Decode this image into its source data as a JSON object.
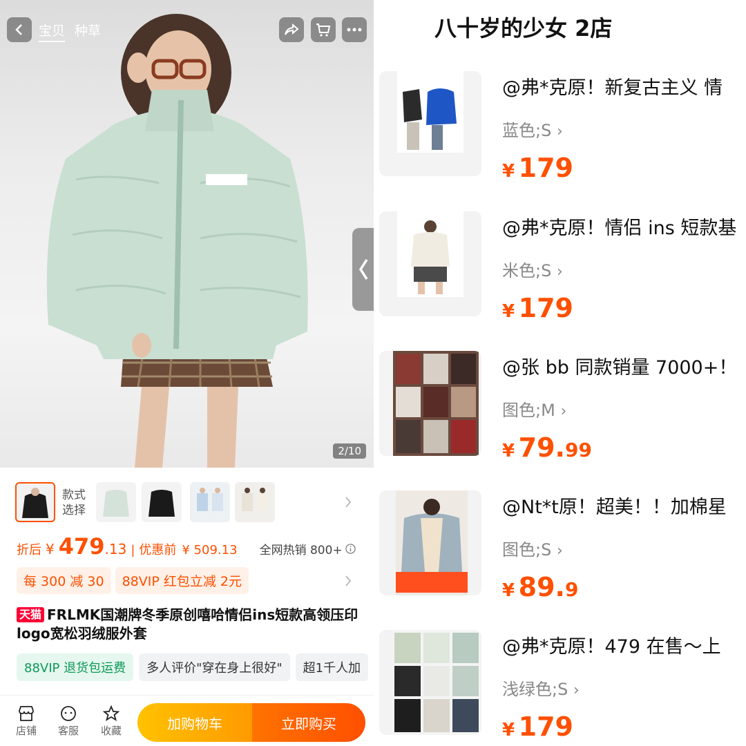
{
  "hero": {
    "tabs": [
      "宝贝",
      "种草"
    ],
    "counter": "2/10",
    "icons": [
      "back-icon",
      "share-icon",
      "cart-icon",
      "more-icon"
    ]
  },
  "style_select": {
    "label_line1": "款式",
    "label_line2": "选择"
  },
  "price": {
    "after_label": "折后",
    "currency": "¥",
    "after_int": "479",
    "after_dec": ".13",
    "divider": "|",
    "before_label": "优惠前",
    "before_value": "¥ 509.13",
    "hot_sale": "全网热销 800+"
  },
  "promos": [
    "每 300 减 30",
    "88VIP 红包立减 2元"
  ],
  "product": {
    "badge": "天猫",
    "title": "FRLMK国潮牌冬季原创嘻哈情侣ins短款高领压印logo宽松羽绒服外套"
  },
  "tags": [
    "88VIP 退货包运费",
    "多人评价\"穿在身上很好\"",
    "超1千人加"
  ],
  "bottom_bar": {
    "shop": "店铺",
    "service": "客服",
    "favorite": "收藏",
    "add_cart": "加购物车",
    "buy_now": "立即购买"
  },
  "shop": {
    "name": "八十岁的少女 2店"
  },
  "orders": [
    {
      "title": "@弗*克原！新复古主义 情",
      "spec": "蓝色;S",
      "currency": "¥",
      "price_int": "179",
      "price_dec": ""
    },
    {
      "title": "@弗*克原！情侣 ins 短款基",
      "spec": "米色;S",
      "currency": "¥",
      "price_int": "179",
      "price_dec": ""
    },
    {
      "title": "@张 bb 同款销量 7000+！",
      "spec": "图色;M",
      "currency": "¥",
      "price_int": "79.",
      "price_dec": "99"
    },
    {
      "title": "@Nt*t原！超美！！加棉星",
      "spec": "图色;S",
      "currency": "¥",
      "price_int": "89.",
      "price_dec": "9"
    },
    {
      "title": "@弗*克原！479 在售～上",
      "spec": "浅绿色;S",
      "currency": "¥",
      "price_int": "179",
      "price_dec": ""
    }
  ],
  "colors": {
    "accent": "#ff4f00",
    "price": "#ff5000",
    "tmall": "#ff0036",
    "green_tag": "#0c9a58"
  }
}
